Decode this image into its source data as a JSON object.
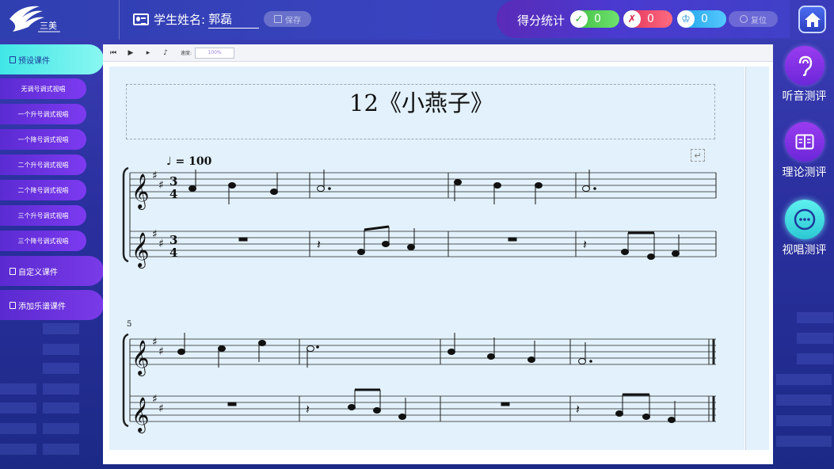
{
  "header": {
    "logo_text": "三美",
    "student_label": "学生姓名:",
    "student_name": "郭磊",
    "save_label": "保存",
    "score_label": "得分统计",
    "correct_count": "0",
    "wrong_count": "0",
    "trophy_count": "0",
    "reset_label": "复位"
  },
  "sidebar": {
    "preset": "预设课件",
    "sub_items": [
      "无调号调式视唱",
      "一个升号调式视唱",
      "一个降号调式视唱",
      "二个升号调式视唱",
      "二个降号调式视唱",
      "三个升号调式视唱",
      "三个降号调式视唱"
    ],
    "custom": "自定义课件",
    "add_score": "添加乐谱课件"
  },
  "toolbar": {
    "speed_label": "速度:",
    "speed_value": "100%"
  },
  "score": {
    "title": "12《小燕子》",
    "tempo": "♩ = 100",
    "measure_number": "5"
  },
  "right_panel": {
    "listen": "听音测评",
    "theory": "理论测评",
    "sing": "视唱测评"
  },
  "colors": {
    "active_teal": "#40e6e6",
    "purple": "#6b27d8",
    "correct_green": "#3fbf3f",
    "wrong_red": "#e0345a",
    "trophy_blue": "#1da3e8"
  }
}
